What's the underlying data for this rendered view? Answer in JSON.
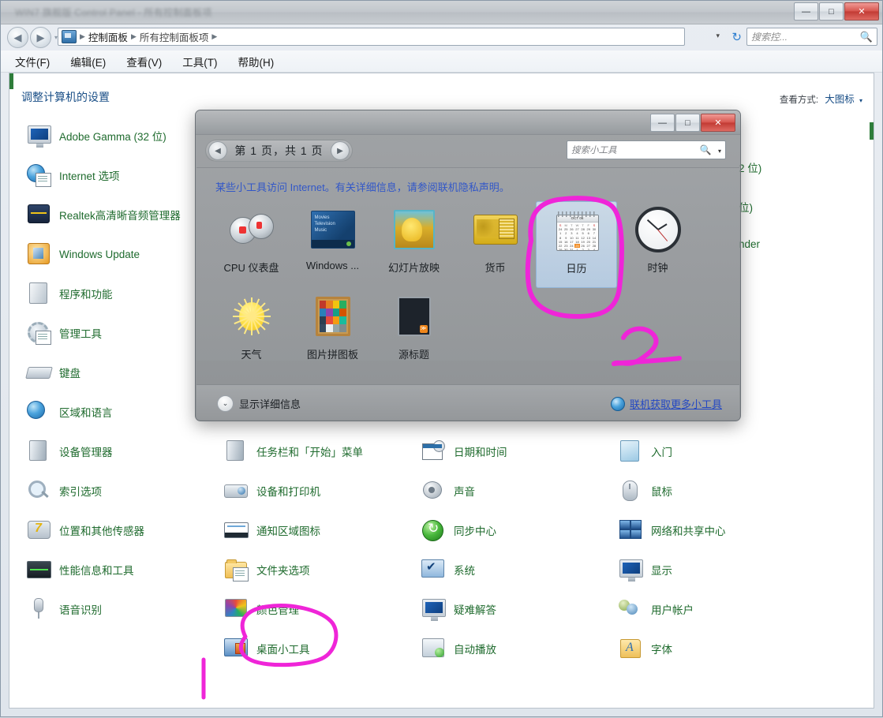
{
  "window": {
    "title": "WIN7 旗舰版 Control Panel - 所有控制面板项",
    "minimize": "—",
    "maximize": "□",
    "close": "✕"
  },
  "addressbar": {
    "back_icon": "◀",
    "forward_icon": "▶",
    "history_caret": "▾",
    "cp_icon": "control-panel-icon",
    "crumbs": [
      "控制面板",
      "所有控制面板项"
    ],
    "separator": "▶",
    "dropdown_caret": "▾",
    "refresh_icon": "↻",
    "search_placeholder": "搜索控...",
    "search_icon": "🔍"
  },
  "menubar": {
    "items": [
      "文件(F)",
      "编辑(E)",
      "查看(V)",
      "工具(T)",
      "帮助(H)"
    ]
  },
  "content_header": {
    "title": "调整计算机的设置",
    "view_by_label": "查看方式:",
    "view_by_value": "大图标",
    "view_by_caret": "▾"
  },
  "control_panel": {
    "columns": [
      {
        "items": [
          {
            "label": "Adobe Gamma (32 位)",
            "icon": "monitor-icon"
          },
          {
            "label": "Internet 选项",
            "icon": "internet-options-icon"
          },
          {
            "label": "Realtek高清晰音频管理器",
            "icon": "realtek-audio-icon"
          },
          {
            "label": "Windows Update",
            "icon": "windows-update-icon"
          },
          {
            "label": "程序和功能",
            "icon": "programs-features-icon"
          },
          {
            "label": "管理工具",
            "icon": "admin-tools-icon"
          },
          {
            "label": "键盘",
            "icon": "keyboard-icon"
          },
          {
            "label": "区域和语言",
            "icon": "region-language-icon"
          },
          {
            "label": "设备管理器",
            "icon": "device-manager-icon"
          },
          {
            "label": "索引选项",
            "icon": "indexing-options-icon"
          },
          {
            "label": "位置和其他传感器",
            "icon": "location-sensors-icon"
          },
          {
            "label": "性能信息和工具",
            "icon": "performance-icon"
          },
          {
            "label": "语音识别",
            "icon": "speech-recognition-icon"
          }
        ]
      },
      {
        "items": [
          {
            "label": "任务栏和「开始」菜单",
            "icon": "taskbar-startmenu-icon"
          },
          {
            "label": "设备和打印机",
            "icon": "devices-printers-icon"
          },
          {
            "label": "通知区域图标",
            "icon": "notification-area-icon"
          },
          {
            "label": "文件夹选项",
            "icon": "folder-options-icon"
          },
          {
            "label": "颜色管理",
            "icon": "color-management-icon"
          },
          {
            "label": "桌面小工具",
            "icon": "desktop-gadgets-icon",
            "circled": true
          }
        ]
      },
      {
        "items": [
          {
            "label": "日期和时间",
            "icon": "date-time-icon"
          },
          {
            "label": "声音",
            "icon": "sound-icon"
          },
          {
            "label": "同步中心",
            "icon": "sync-center-icon"
          },
          {
            "label": "系统",
            "icon": "system-icon"
          },
          {
            "label": "疑难解答",
            "icon": "troubleshooting-icon"
          },
          {
            "label": "自动播放",
            "icon": "autoplay-icon"
          }
        ]
      },
      {
        "items": [
          {
            "label": "入门",
            "icon": "getting-started-icon"
          },
          {
            "label": "鼠标",
            "icon": "mouse-icon"
          },
          {
            "label": "网络和共享中心",
            "icon": "network-sharing-icon"
          },
          {
            "label": "显示",
            "icon": "display-icon"
          },
          {
            "label": "用户帐户",
            "icon": "user-accounts-icon"
          },
          {
            "label": "字体",
            "icon": "fonts-icon"
          }
        ]
      }
    ],
    "occluded_labels": [
      "2 位)",
      "位)",
      "nder"
    ]
  },
  "gadget_dialog": {
    "minimize": "—",
    "maximize": "□",
    "close": "✕",
    "pager": {
      "prev": "◀",
      "next": "▶",
      "text": "第 1 页，共 1 页"
    },
    "search_placeholder": "搜索小工具",
    "search_icon": "🔍",
    "search_caret": "▾",
    "privacy_notice": "某些小工具访问 Internet。有关详细信息，请参阅联机隐私声明。",
    "gadgets": [
      {
        "name": "CPU 仪表盘",
        "icon": "cpu-meter-icon",
        "selected": false
      },
      {
        "name": "Windows ...",
        "icon": "windows-media-center-icon",
        "selected": false
      },
      {
        "name": "幻灯片放映",
        "icon": "slideshow-icon",
        "selected": false
      },
      {
        "name": "货币",
        "icon": "currency-icon",
        "selected": false
      },
      {
        "name": "日历",
        "icon": "calendar-icon",
        "selected": true
      },
      {
        "name": "时钟",
        "icon": "clock-icon",
        "selected": false
      },
      {
        "name": "天气",
        "icon": "weather-icon",
        "selected": false
      },
      {
        "name": "图片拼图板",
        "icon": "picture-puzzle-icon",
        "selected": false
      },
      {
        "name": "源标题",
        "icon": "feed-headlines-icon",
        "selected": false
      }
    ],
    "calendar_thumb": {
      "header": "OCT 06",
      "weekdays": [
        "S",
        "M",
        "T",
        "W",
        "T",
        "F",
        "S"
      ],
      "weeks": [
        [
          "24",
          "25",
          "26",
          "27",
          "28",
          "29",
          "30"
        ],
        [
          "1",
          "2",
          "3",
          "4",
          "5",
          "6",
          "7"
        ],
        [
          "8",
          "9",
          "10",
          "11",
          "12",
          "13",
          "14"
        ],
        [
          "15",
          "16",
          "17",
          "18",
          "19",
          "20",
          "21"
        ],
        [
          "22",
          "23",
          "24",
          "25",
          "26",
          "27",
          "28"
        ],
        [
          "29",
          "30",
          "31",
          "1",
          "2",
          "3",
          "4"
        ]
      ],
      "highlight": "25"
    },
    "footer": {
      "show_details_caret": "⌄",
      "show_details": "显示详细信息",
      "get_more_icon": "globe-icon",
      "get_more": "联机获取更多小工具"
    }
  },
  "annotations": {
    "color": "#ef25d8",
    "marks": [
      {
        "name": "circle-around-calendar-gadget",
        "shape": "ellipse"
      },
      {
        "name": "handwritten-digit-2",
        "text": "2"
      },
      {
        "name": "circle-around-desktop-gadgets",
        "shape": "ellipse"
      },
      {
        "name": "vertical-pointer-line",
        "shape": "line"
      }
    ]
  }
}
